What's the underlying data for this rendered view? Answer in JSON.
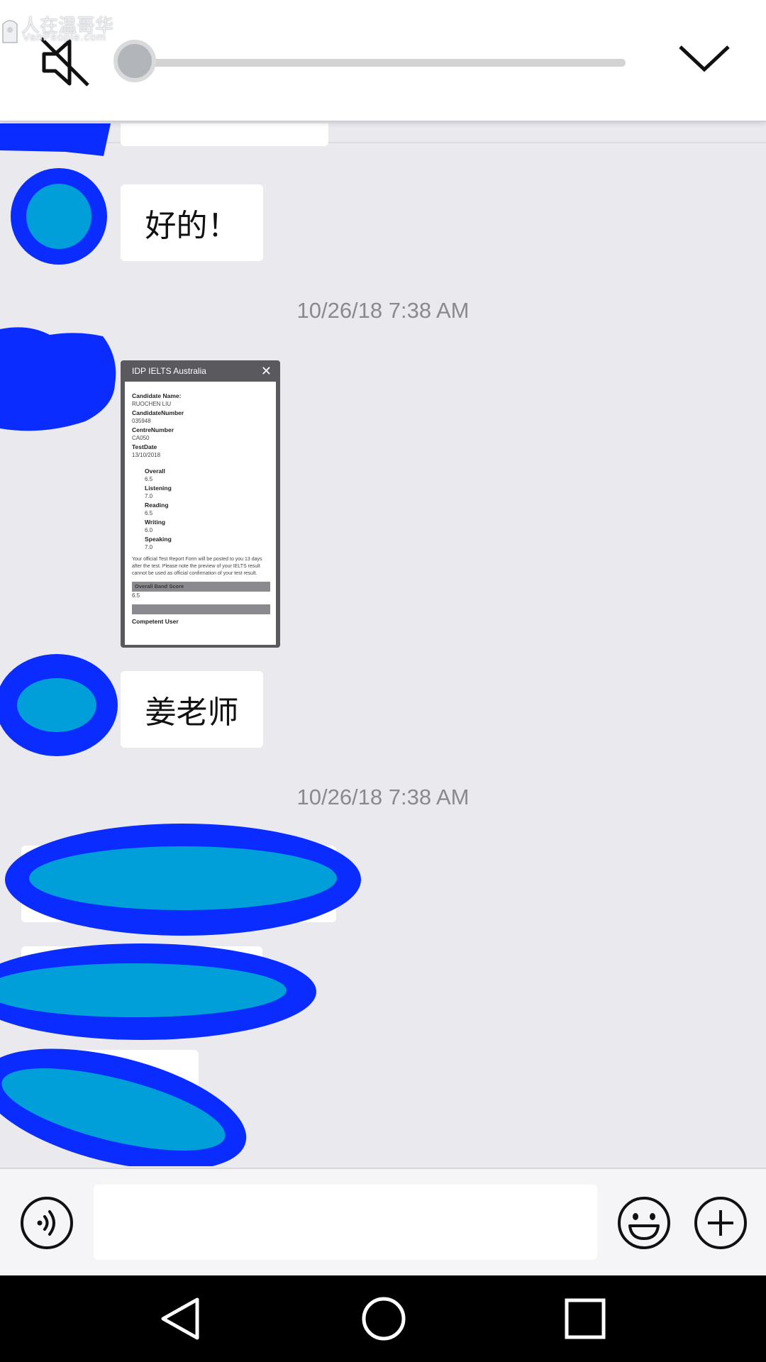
{
  "watermark": {
    "line1": "人在温哥华",
    "line2": "VanPeople.com"
  },
  "topbar": {
    "mute_icon": "speaker-muted-icon",
    "collapse_icon": "chevron-down-icon",
    "progress": 0.0
  },
  "chat": {
    "messages": [
      {
        "type": "text",
        "text": "好的！"
      },
      {
        "type": "timestamp",
        "text": "10/26/18 7:38 AM"
      },
      {
        "type": "image",
        "description_icon": "ielts-result-screenshot"
      },
      {
        "type": "text",
        "text": "姜老师"
      },
      {
        "type": "timestamp",
        "text": "10/26/18 7:38 AM"
      }
    ]
  },
  "ielts": {
    "header": "IDP IELTS Australia",
    "close": "✕",
    "candidate_name_label": "Candidate Name:",
    "candidate_name": "RUOCHEN LIU",
    "candidate_number_label": "CandidateNumber",
    "candidate_number": "035948",
    "centre_number_label": "CentreNumber",
    "centre_number": "CA050",
    "test_date_label": "TestDate",
    "test_date": "13/10/2018",
    "scores": [
      {
        "label": "Overall",
        "value": "6.5"
      },
      {
        "label": "Listening",
        "value": "7.0"
      },
      {
        "label": "Reading",
        "value": "6.5"
      },
      {
        "label": "Writing",
        "value": "6.0"
      },
      {
        "label": "Speaking",
        "value": "7.0"
      }
    ],
    "note": "Your official Test Report Form will be posted to you 13 days after the test. Please note the preview of your IELTS result cannot be used as official confirmation of your test result.",
    "overall_band_label": "Overall Band Score",
    "overall_band_value": "6.5",
    "band_description": "Competent User"
  },
  "inputbar": {
    "voice_icon": "voice-input-icon",
    "placeholder": "",
    "emoji_icon": "emoji-icon",
    "plus_icon": "plus-icon"
  },
  "navbar": {
    "back_icon": "back-triangle-icon",
    "home_icon": "home-circle-icon",
    "recent_icon": "recent-apps-square-icon"
  },
  "colors": {
    "scribble_outer": "#0a2cff",
    "scribble_inner": "#009fd9",
    "chat_bg": "#eaeaee",
    "bubble_bg": "#ffffff",
    "timestamp": "#8a8a8e"
  }
}
